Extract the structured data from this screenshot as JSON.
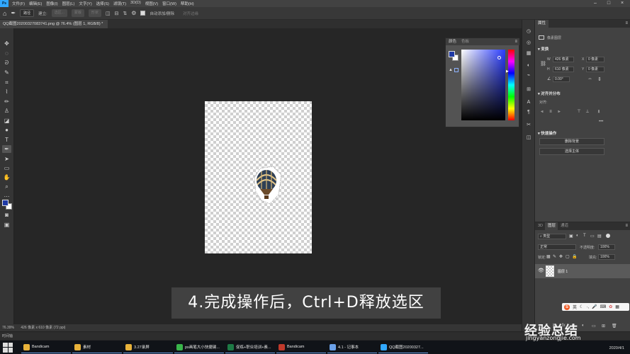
{
  "menubar": {
    "items": [
      "文件(F)",
      "编辑(E)",
      "图像(I)",
      "图层(L)",
      "文字(Y)",
      "选择(S)",
      "滤镜(T)",
      "3D(D)",
      "视图(V)",
      "窗口(W)",
      "帮助(H)"
    ]
  },
  "options": {
    "path_mode": "路径",
    "build_label": "建立:",
    "selection_btn": "选区...",
    "mask_btn": "蒙版",
    "shape_btn": "形状",
    "auto_add_delete": "自动添加/删除",
    "align_edges": "对齐边缘"
  },
  "document": {
    "tab_title": "QQ截图20200327083741.png @ 76.4% (图层 1, RGB/8) *"
  },
  "colorpanel": {
    "tab_color": "颜色",
    "tab_swatches": "色板",
    "fg_color": "#1f3aa6",
    "bg_color": "#ffffff"
  },
  "properties": {
    "tab": "属性",
    "doc_label": "像素图层",
    "transform_title": "变换",
    "w_label": "W",
    "w_value": "426 像素",
    "h_label": "H",
    "h_value": "610 像素",
    "x_label": "X",
    "x_value": "0 像素",
    "y_label": "Y",
    "y_value": "0 像素",
    "angle_value": "0.00°",
    "align_title": "对齐并分布",
    "align_label": "对齐:",
    "quick_title": "快速操作",
    "remove_bg_btn": "删除背景",
    "select_subject_btn": "选择主体"
  },
  "layers": {
    "tab_3d": "3D",
    "tab_layers": "图层",
    "tab_channels": "通道",
    "filter_kind": "类型",
    "blend_mode": "正常",
    "opacity_label": "不透明度:",
    "opacity_value": "100%",
    "lock_label": "锁定:",
    "fill_label": "填充:",
    "fill_value": "100%",
    "layer_name": "图层 1"
  },
  "status": {
    "zoom": "76.39%",
    "doc_size": "426 像素 x 610 像素 (72 ppi)",
    "timeline": "时间轴"
  },
  "caption": "4.完成操作后，Ctrl+D释放选区",
  "taskbar": {
    "items": [
      {
        "label": "Bandicam",
        "color": "#e8b23a"
      },
      {
        "label": "素材",
        "color": "#e8b23a"
      },
      {
        "label": "3.27录屏",
        "color": "#e8b23a"
      },
      {
        "label": "ps画笔大小快捷键...",
        "color": "#39b54a"
      },
      {
        "label": "促练+职业培训+素...",
        "color": "#1d7a45"
      },
      {
        "label": "Bandicam",
        "color": "#c0392b"
      },
      {
        "label": "4.1 - 记事本",
        "color": "#6aa0e8"
      },
      {
        "label": "QQ截图20200327...",
        "color": "#31a8ff"
      }
    ],
    "date": "2020/4/1"
  },
  "watermark": {
    "cn": "经验总结",
    "en": "jingyanzongjie.com"
  },
  "sogou": {
    "letter": "S",
    "mode": "英"
  }
}
